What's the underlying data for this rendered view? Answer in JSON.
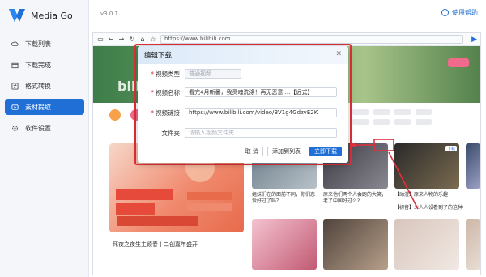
{
  "app": {
    "name": "Media Go",
    "version": "v3.0.1",
    "help": "使用帮助"
  },
  "sidebar": {
    "items": [
      {
        "label": "下载列表",
        "icon": "cloud-download-icon"
      },
      {
        "label": "下载完成",
        "icon": "folder-icon"
      },
      {
        "label": "格式转换",
        "icon": "convert-icon"
      },
      {
        "label": "素材提取",
        "icon": "extract-icon",
        "active": true
      },
      {
        "label": "软件设置",
        "icon": "gear-icon"
      }
    ]
  },
  "browser": {
    "url": "https://www.bilibili.com"
  },
  "page": {
    "logo": "bilibili",
    "feature_caption": "死夜之夜生主颖春丨二创嘉年盛开",
    "cards": [
      {
        "caption": "姐妹们在的面前不同，你们恋爱好过了吗？",
        "badge": ""
      },
      {
        "caption": "原来他们两个人会跑的大笑，老了中国好过么?",
        "badge": ""
      },
      {
        "caption": "【动漫】原来人物的乐趣",
        "badge": ""
      },
      {
        "caption": "【初音】少人人设看到了的这种",
        "badge": "下载"
      }
    ]
  },
  "dialog": {
    "title": "编辑下载",
    "fields": [
      {
        "label": "视频类型",
        "value": "普通视频",
        "required": true
      },
      {
        "label": "视频名称",
        "value": "看完4月新番，我灵魂洗涤！再无恶意....【远式】",
        "required": true
      },
      {
        "label": "视频链接",
        "value": "https://www.bilibili.com/video/BV1g4GdzvE2K",
        "required": true
      },
      {
        "label": "文件夹",
        "value": "",
        "placeholder": "请输入视频文件夹",
        "required": false
      }
    ],
    "buttons": {
      "cancel": "取 消",
      "add": "添加到列表",
      "download": "立即下载"
    }
  },
  "colors": {
    "accent": "#1f6fd6",
    "highlight": "#e0303a"
  }
}
